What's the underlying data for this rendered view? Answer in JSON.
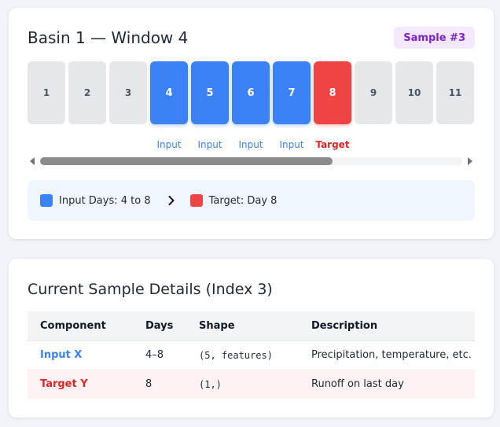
{
  "window_card": {
    "title": "Basin 1 — Window 4",
    "sample_badge": "Sample #3",
    "days": [
      {
        "num": "1",
        "role": "none",
        "label": ""
      },
      {
        "num": "2",
        "role": "none",
        "label": ""
      },
      {
        "num": "3",
        "role": "none",
        "label": ""
      },
      {
        "num": "4",
        "role": "input",
        "label": "Input"
      },
      {
        "num": "5",
        "role": "input",
        "label": "Input"
      },
      {
        "num": "6",
        "role": "input",
        "label": "Input"
      },
      {
        "num": "7",
        "role": "input",
        "label": "Input"
      },
      {
        "num": "8",
        "role": "target",
        "label": "Target"
      },
      {
        "num": "9",
        "role": "none",
        "label": ""
      },
      {
        "num": "10",
        "role": "none",
        "label": ""
      },
      {
        "num": "11",
        "role": "none",
        "label": ""
      }
    ],
    "legend": {
      "input_text": "Input Days: 4 to 8",
      "target_text": "Target: Day 8"
    }
  },
  "details_card": {
    "title": "Current Sample Details (Index 3)",
    "columns": [
      "Component",
      "Days",
      "Shape",
      "Description"
    ],
    "rows": [
      {
        "component": "Input X",
        "days": "4–8",
        "shape": "(5, features)",
        "description": "Precipitation, temperature, etc."
      },
      {
        "component": "Target Y",
        "days": "8",
        "shape": "(1,)",
        "description": "Runoff on last day"
      }
    ]
  },
  "colors": {
    "input": "#3b82f6",
    "target": "#ef4444",
    "badge_bg": "#f3e8ff",
    "badge_text": "#7e22ce"
  }
}
